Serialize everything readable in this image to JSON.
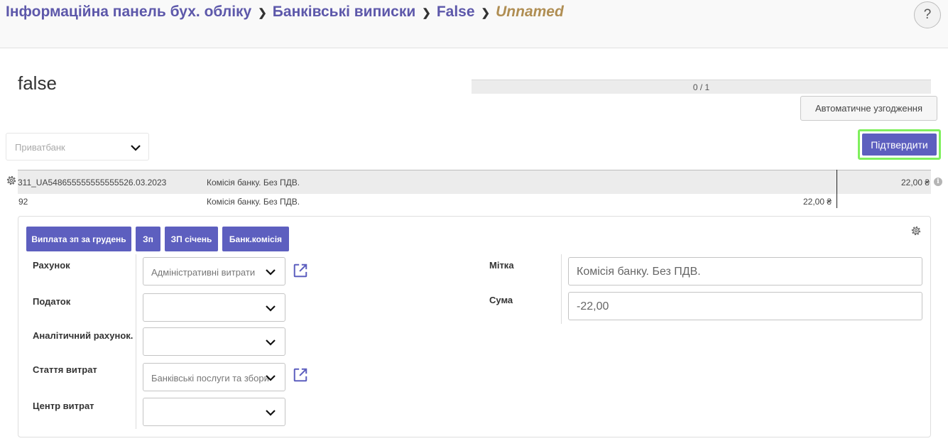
{
  "breadcrumb": {
    "items": [
      "Інформаційна панель бух. обліку",
      "Банківські виписки",
      "False"
    ],
    "current": "Unnamed"
  },
  "help": {
    "label": "?"
  },
  "page": {
    "title": "false"
  },
  "progress": {
    "text": "0 / 1",
    "done": 0,
    "total": 1
  },
  "buttons": {
    "auto_reconcile": "Автоматичне узгодження",
    "confirm": "Підтвердити"
  },
  "journal": {
    "value": "Приватбанк"
  },
  "statement_line": {
    "reference": "311_UA548655555555555526.03.2023",
    "label": "Комісія банку. Без ПДВ.",
    "amount": "22,00 ₴"
  },
  "move_line": {
    "reference": "92",
    "label": "Комісія банку. Без ПДВ.",
    "amount": "22,00 ₴"
  },
  "reconcile_models": [
    "Виплата зп за грудень",
    "Зп",
    "ЗП січень",
    "Банк.комісія"
  ],
  "form": {
    "labels": {
      "account": "Рахунок",
      "tax": "Податок",
      "analytic": "Аналітичний рахунок.",
      "expense": "Стаття витрат",
      "cost_center": "Центр витрат",
      "label": "Мітка",
      "amount": "Сума"
    },
    "values": {
      "account": "Адміністративні витрати",
      "tax": "",
      "analytic": "",
      "expense": "Банківські послуги та збори",
      "cost_center": "",
      "label": "Комісія банку. Без ПДВ.",
      "amount": "-22,00"
    }
  },
  "colors": {
    "accent": "#5d5fbf",
    "breadcrumb": "#5d58aa",
    "breadcrumb_current": "#b08e53",
    "highlight_border": "#7ff05d"
  },
  "icons": {
    "gear": "gear-icon",
    "chevron": "chevron-down-icon",
    "external": "external-link-icon",
    "info": "info-icon"
  }
}
